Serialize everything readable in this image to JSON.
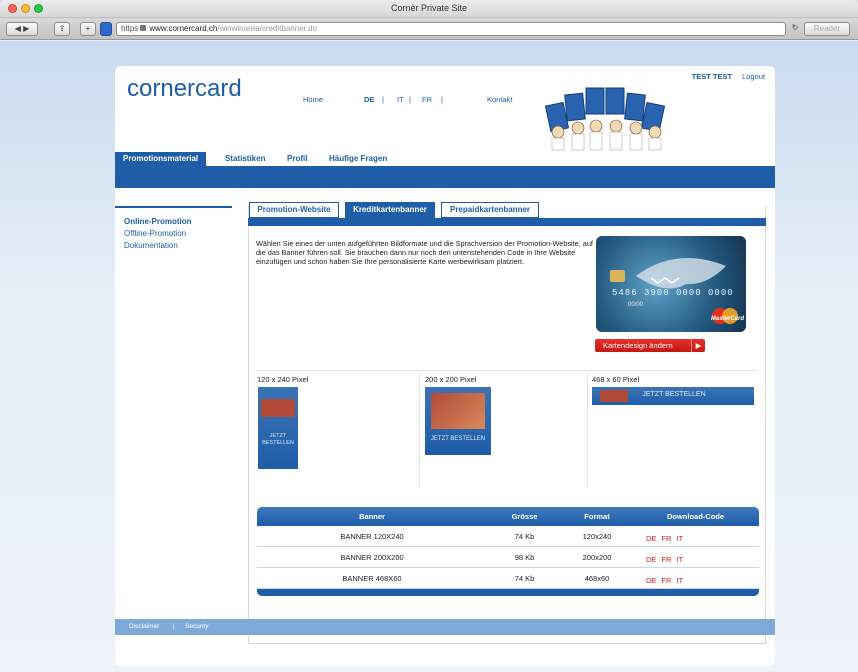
{
  "window": {
    "title": "Cornèr Private Site"
  },
  "browser": {
    "url_scheme": "https",
    "url_host": "www.cornercard.ch",
    "url_path": "/winwinarea/creditbanner.do",
    "reader_label": "Reader"
  },
  "header": {
    "logo": "cornercard",
    "nav": {
      "home": "Home",
      "lang_de": "DE",
      "sep": "|",
      "lang_it": "IT",
      "lang_fr": "FR",
      "contact": "Kontakt"
    },
    "user": {
      "name": "TEST TEST",
      "logout": "Logout"
    }
  },
  "mainnav": [
    {
      "label": "Promotionsmaterial",
      "active": true
    },
    {
      "label": "Statistiken",
      "active": false
    },
    {
      "label": "Profil",
      "active": false
    },
    {
      "label": "Häufige Fragen",
      "active": false
    }
  ],
  "sidebar": [
    {
      "label": "Online-Promotion",
      "active": true
    },
    {
      "label": "Offline-Promotion",
      "active": false
    },
    {
      "label": "Dokumentation",
      "active": false
    }
  ],
  "tabs": [
    {
      "label": "Promotion-Website",
      "active": false
    },
    {
      "label": "Kreditkartenbanner",
      "active": true
    },
    {
      "label": "Prepaidkartenbanner",
      "active": false
    }
  ],
  "intro": "Wählen Sie eines der unten aufgeführten Bildformate und die Sprachversion der Promotion-Website, auf die das Banner führen soll. Sie brauchen dann nur noch den untenstehenden Code in Ihre Website einzufügen und schon haben Sie Ihre personalisierte Karte werbewirksam platziert.",
  "card": {
    "number": "5486 3900 0000 0000",
    "date": "00/00",
    "brand": "MasterCard",
    "button": "Kartendesign ändern"
  },
  "banners": [
    {
      "label": "120 x 240 Pixel",
      "cta": "JETZT BESTELLEN"
    },
    {
      "label": "200 x 200 Pixel",
      "cta": "JETZT BESTELLEN"
    },
    {
      "label": "468 x 60 Pixel",
      "cta": "JETZT BESTELLEN"
    }
  ],
  "table": {
    "headers": [
      "Banner",
      "Grösse",
      "Format",
      "Download-Code"
    ],
    "rows": [
      {
        "banner": "BANNER 120X240",
        "size": "74 Kb",
        "format": "120x240",
        "codes": [
          "DE",
          "FR",
          "IT"
        ]
      },
      {
        "banner": "BANNER 200X200",
        "size": "98 Kb",
        "format": "200x200",
        "codes": [
          "DE",
          "FR",
          "IT"
        ]
      },
      {
        "banner": "BANNER 468X60",
        "size": "74 Kb",
        "format": "468x60",
        "codes": [
          "DE",
          "FR",
          "IT"
        ]
      }
    ]
  },
  "footer": {
    "disclaimer": "Disclaimer",
    "sep": "|",
    "security": "Security"
  },
  "colors": {
    "brand_blue": "#1f5da8",
    "red": "#d41d1d"
  }
}
